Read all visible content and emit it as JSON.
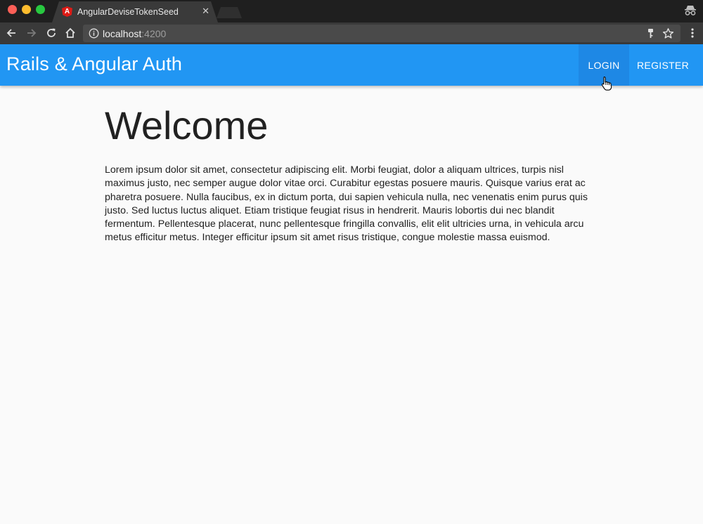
{
  "browser": {
    "tab": {
      "title": "AngularDeviseTokenSeed",
      "favicon": "angular-icon"
    },
    "url": {
      "host": "localhost",
      "port": ":4200"
    }
  },
  "app": {
    "title": "Rails & Angular Auth",
    "nav": {
      "login": "LOGIN",
      "register": "REGISTER"
    },
    "accent_color": "#2196f3"
  },
  "main": {
    "heading": "Welcome",
    "paragraph": "Lorem ipsum dolor sit amet, consectetur adipiscing elit. Morbi feugiat, dolor a aliquam ultrices, turpis nisl maximus justo, nec semper augue dolor vitae orci. Curabitur egestas posuere mauris. Quisque varius erat ac pharetra posuere. Nulla faucibus, ex in dictum porta, dui sapien vehicula nulla, nec venenatis enim purus quis justo. Sed luctus luctus aliquet. Etiam tristique feugiat risus in hendrerit. Mauris lobortis dui nec blandit fermentum. Pellentesque placerat, nunc pellentesque fringilla convallis, elit elit ultricies urna, in vehicula arcu metus efficitur metus. Integer efficitur ipsum sit amet risus tristique, congue molestie massa euismod."
  }
}
